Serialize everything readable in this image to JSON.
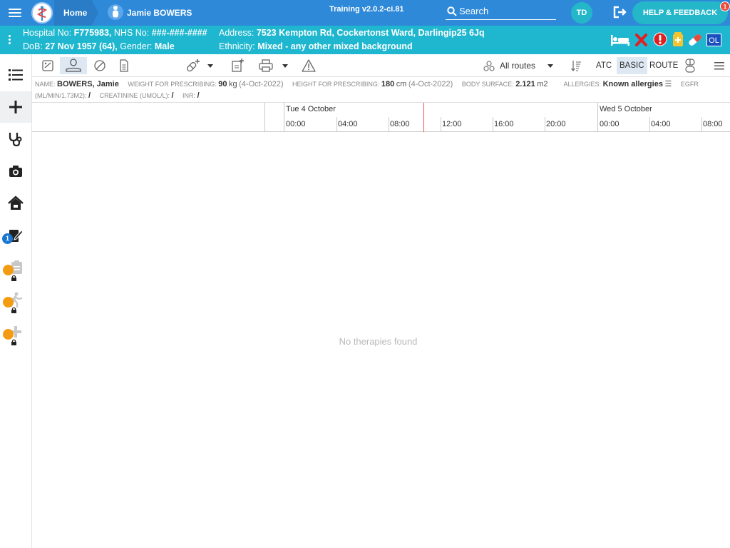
{
  "topbar": {
    "home_label": "Home",
    "patient_name": "Jamie BOWERS",
    "version": "Training v2.0.2-ci.81",
    "search_label": "Search",
    "user_initials": "TD",
    "help_label": "HELP & FEEDBACK",
    "help_badge": "1",
    "colors": {
      "bar": "#2f89d9",
      "accent": "#24b6c9"
    }
  },
  "banner": {
    "hospital_label": "Hospital No:",
    "hospital_no": "F775983,",
    "nhs_label": "NHS No:",
    "nhs_no": "###-###-####",
    "dob_label": "DoB:",
    "dob": "27 Nov 1957 (64),",
    "gender_label": "Gender:",
    "gender": "Male",
    "address_label": "Address:",
    "address": "7523 Kempton Rd, Cockertonst Ward, Darlingip25 6Jq",
    "ethnicity_label": "Ethnicity:",
    "ethnicity": "Mixed - any other mixed background",
    "ol_badge": "OL",
    "icons": [
      "bed-icon",
      "cross-icon",
      "alert-icon",
      "medication-icon",
      "pill-icon"
    ]
  },
  "sidebar": {
    "items": [
      {
        "name": "list-icon"
      },
      {
        "name": "add-icon"
      },
      {
        "name": "stethoscope-icon"
      },
      {
        "name": "camera-icon"
      },
      {
        "name": "home-icon"
      },
      {
        "name": "notes-icon",
        "badge": "1"
      },
      {
        "name": "clipboard-icon",
        "locked": true
      },
      {
        "name": "walking-icon",
        "locked": true
      },
      {
        "name": "plus-icon",
        "locked": true
      }
    ]
  },
  "toolbar": {
    "routes_label": "All routes",
    "atc_label": "ATC",
    "basic_label": "BASIC",
    "route_label": "ROUTE"
  },
  "info": {
    "name_label": "Name:",
    "name": "BOWERS, Jamie",
    "weight_label": "Weight for prescribing:",
    "weight_value": "90",
    "weight_unit": "kg",
    "weight_date": "(4-Oct-2022)",
    "height_label": "Height for prescribing:",
    "height_value": "180",
    "height_unit": "cm",
    "height_date": "(4-Oct-2022)",
    "bsa_label": "Body surface:",
    "bsa_value": "2.121",
    "bsa_unit": "m2",
    "allergies_label": "Allergies:",
    "allergies_value": "Known allergies",
    "egfr_label": "eGFR",
    "egfr_unit": "(ml/min/1.73m2):",
    "egfr_value": "/",
    "creatinine_label": "Creatinine (umol/l):",
    "creatinine_value": "/",
    "inr_label": "INR:",
    "inr_value": "/"
  },
  "timeline": {
    "days": [
      "Tue 4 October",
      "Wed 5 October"
    ],
    "times": [
      "00:00",
      "04:00",
      "08:00",
      "12:00",
      "16:00",
      "20:00",
      "00:00",
      "04:00",
      "08:00"
    ]
  },
  "main": {
    "empty_message": "No therapies found"
  }
}
